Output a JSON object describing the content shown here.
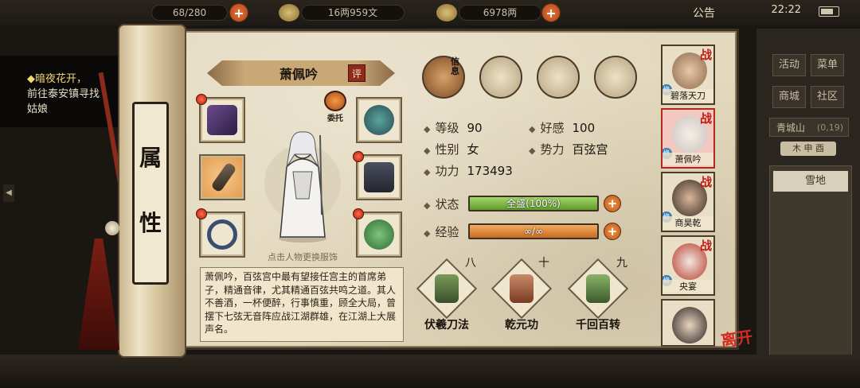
{
  "topbar": {
    "capacity": "68/280",
    "money": "16两959文",
    "gold": "6978两",
    "notice": "公告",
    "time": "22:22"
  },
  "quest": {
    "title": "◆暗夜花开，",
    "line1": "前往泰安镇寻找",
    "line2": "姑娘"
  },
  "scroll_label": [
    "属",
    "性"
  ],
  "character": {
    "name": "萧佩吟",
    "rate_label": "评",
    "entrust_label": "委托",
    "portrait_hint": "点击人物更换服饰",
    "bio": "萧佩吟，百弦宫中最有望接任宫主的首席弟子，精通音律，尤其精通百弦共鸣之道。其人不善酒，一杯便醉，行事慎重，顾全大局，曾摆下七弦无音阵应战江湖群雄，在江湖上大展声名。"
  },
  "tabs": {
    "info_label": "信息"
  },
  "stats": {
    "level_label": "等级",
    "level": "90",
    "favor_label": "好感",
    "favor": "100",
    "gender_label": "性别",
    "gender": "女",
    "faction_label": "势力",
    "faction": "百弦宫",
    "power_label": "功力",
    "power": "173493",
    "state_label": "状态",
    "state_value": "全盛(100%)",
    "state_fill": 1.0,
    "exp_label": "经验",
    "exp_value": "∞/∞",
    "exp_fill": 1.0
  },
  "skills": [
    {
      "level": "八",
      "name": "伏羲刀法"
    },
    {
      "level": "十",
      "name": "乾元功"
    },
    {
      "level": "九",
      "name": "千回百转"
    }
  ],
  "team": [
    {
      "name": "碧落天刀",
      "tag": "战",
      "badge": "修"
    },
    {
      "name": "萧佩吟",
      "tag": "战",
      "badge": "修"
    },
    {
      "name": "商昊乾",
      "tag": "战",
      "badge": "修"
    },
    {
      "name": "央宴",
      "tag": "战",
      "badge": "修"
    },
    {
      "name": "",
      "tag": "",
      "badge": ""
    }
  ],
  "leave_label": "离开",
  "rightpanel": {
    "activity": "活动",
    "menu": "菜单",
    "shop": "商城",
    "community": "社区",
    "location": "青城山",
    "coords": "(0,19)",
    "tabs": "木 申 酉",
    "area": "雪地"
  },
  "colors": {
    "parchment": "#e3d9be",
    "state_bar": "#7cb83e",
    "exp_bar": "#e08a38",
    "accent_red": "#c21a14"
  }
}
